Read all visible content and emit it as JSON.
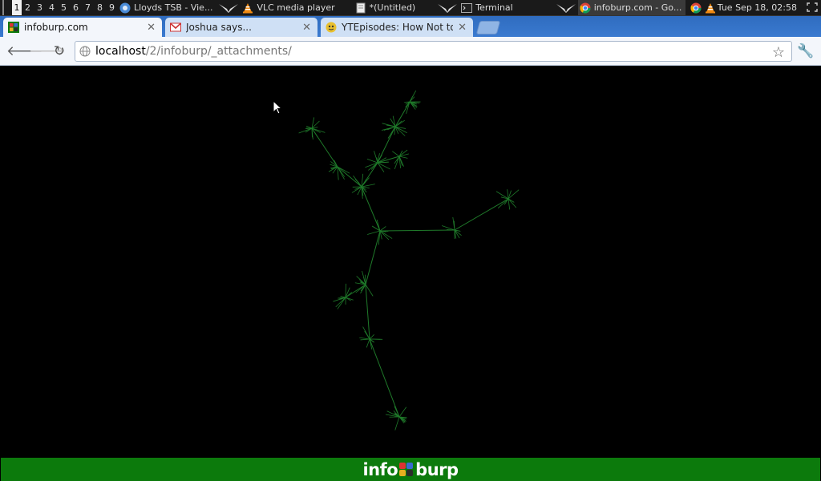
{
  "panel": {
    "workspaces": [
      "1",
      "2",
      "3",
      "4",
      "5",
      "6",
      "7",
      "8",
      "9"
    ],
    "active_workspace": "1",
    "tasks": [
      {
        "name": "lloyds",
        "label": "Lloyds TSB - Vie..."
      },
      {
        "name": "vlc",
        "label": "VLC media player"
      },
      {
        "name": "untitled",
        "label": "*(Untitled)"
      },
      {
        "name": "terminal",
        "label": "Terminal"
      },
      {
        "name": "chrome",
        "label": "infoburp.com - Go..."
      }
    ],
    "clock": "Tue Sep 18, 02:58"
  },
  "tabs": [
    {
      "title": "infoburp.com",
      "active": true
    },
    {
      "title": "Joshua says...",
      "active": false
    },
    {
      "title": "YTEpisodes: How Not to",
      "active": false
    }
  ],
  "toolbar": {
    "url_host": "localhost",
    "url_path": "/2/infoburp/_attachments/"
  },
  "footer": {
    "logo_left": "info",
    "logo_right": "burp"
  },
  "colors": {
    "graph": "#1f7a2a",
    "footer_bg": "#0c7a0c",
    "tab_strip": "#3a7ad0"
  }
}
